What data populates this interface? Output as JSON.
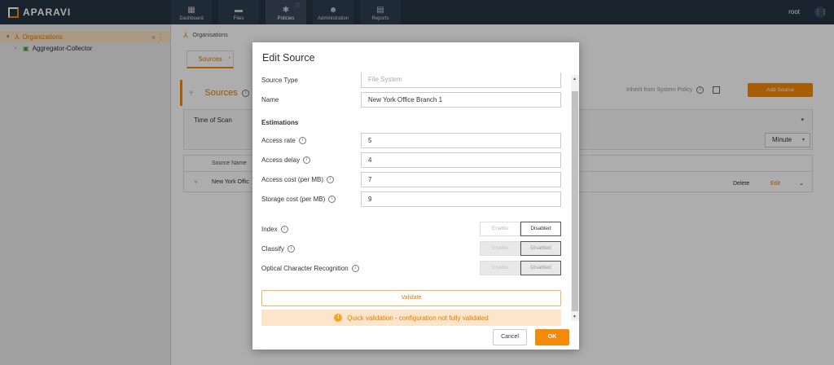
{
  "app": {
    "logo_text": "APARAVI",
    "user": "root",
    "nav": [
      {
        "label": "Dashboard",
        "icon": "dashboard-icon"
      },
      {
        "label": "Files",
        "icon": "folder-icon"
      },
      {
        "label": "Policies",
        "icon": "gear-icon",
        "badge": "ⓘ"
      },
      {
        "label": "Administration",
        "icon": "users-icon"
      },
      {
        "label": "Reports",
        "icon": "report-icon"
      }
    ]
  },
  "sidebar": {
    "items": [
      {
        "label": "Organizations",
        "selected": true
      },
      {
        "label": "Aggregator-Collector"
      }
    ]
  },
  "main": {
    "breadcrumb": "Organisations",
    "tab_label": "Sources",
    "tab_marker": "*",
    "panel_title": "Sources",
    "inherit_label": "Inherit from System Policy",
    "add_source_label": "Add Source",
    "time_of_scan_label": "Time of Scan",
    "minute_label": "Minute",
    "table_header": "Source Name",
    "row": {
      "name": "New York Offic",
      "delete": "Delete",
      "edit": "Edit"
    }
  },
  "modal": {
    "title": "Edit Source",
    "source_type_label": "Source Type",
    "source_type_value": "File System",
    "name_label": "Name",
    "name_value": "New York Office Branch 1",
    "estimations_label": "Estimations",
    "fields": [
      {
        "label": "Access rate",
        "value": "5"
      },
      {
        "label": "Access delay",
        "value": "4"
      },
      {
        "label": "Access cost (per MB)",
        "value": "7"
      },
      {
        "label": "Storage cost (per MB)",
        "value": "9"
      }
    ],
    "toggles": [
      {
        "label": "Index",
        "enable": "Enable",
        "disabled": "Disabled"
      },
      {
        "label": "Classify",
        "enable": "Enable",
        "disabled": "Disabled"
      },
      {
        "label": "Optical Character Recognition",
        "enable": "Enable",
        "disabled": "Disabled"
      }
    ],
    "validate_label": "Validate",
    "warning_text": "Quick validation - configuration not fully validated",
    "cancel_label": "Cancel",
    "ok_label": "OK"
  },
  "colors": {
    "accent": "#f5890a",
    "nav_bg": "#263445",
    "warning_bg": "#fde5cc"
  }
}
